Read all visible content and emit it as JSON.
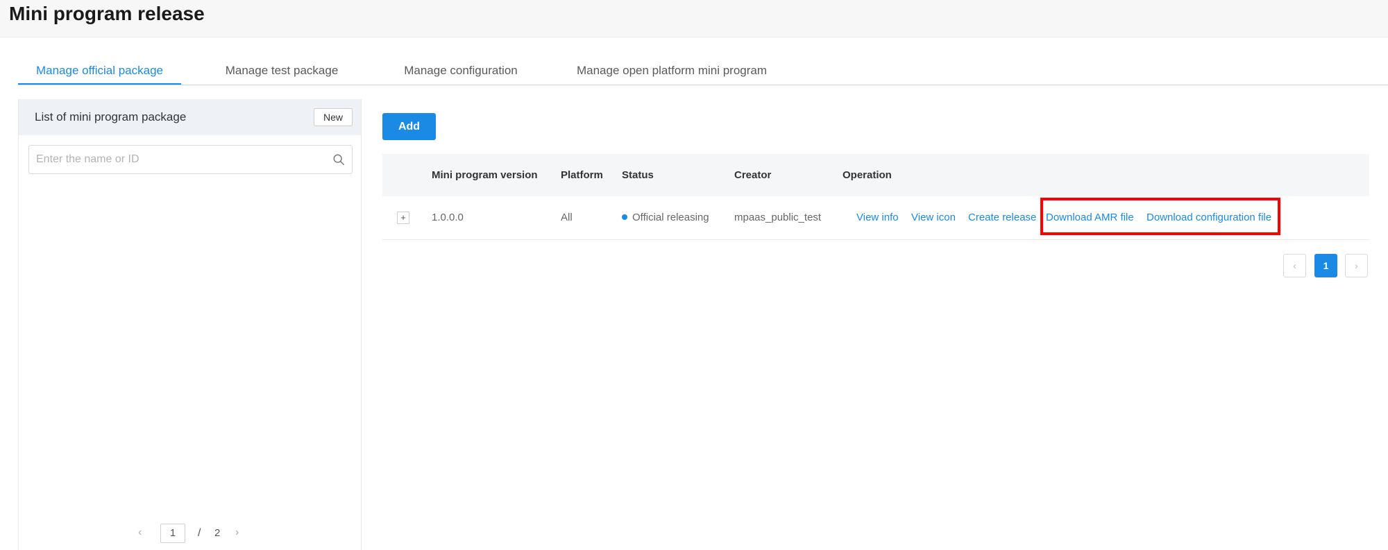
{
  "header": {
    "title": "Mini program release"
  },
  "tabs": [
    {
      "label": "Manage official package"
    },
    {
      "label": "Manage test package"
    },
    {
      "label": "Manage configuration"
    },
    {
      "label": "Manage open platform mini program"
    }
  ],
  "sidebar": {
    "title": "List of mini program package",
    "new_label": "New",
    "search_placeholder": "Enter the name or ID",
    "pagination": {
      "prev": "‹",
      "current": "1",
      "separator": "/",
      "total": "2",
      "next": "›"
    }
  },
  "main": {
    "add_label": "Add",
    "table": {
      "columns": [
        "Mini program version",
        "Platform",
        "Status",
        "Creator",
        "Operation"
      ],
      "rows": [
        {
          "expand": "+",
          "version": "1.0.0.0",
          "platform": "All",
          "status": "Official releasing",
          "creator": "mpaas_public_test",
          "operations": [
            "View info",
            "View icon",
            "Create release",
            "Download AMR file",
            "Download configuration file"
          ]
        }
      ]
    },
    "pagination": {
      "prev": "‹",
      "current": "1",
      "next": "›"
    }
  },
  "colors": {
    "accent": "#1a8ae5",
    "highlight": "#ff0000",
    "header_bg": "#f7f7f7"
  }
}
